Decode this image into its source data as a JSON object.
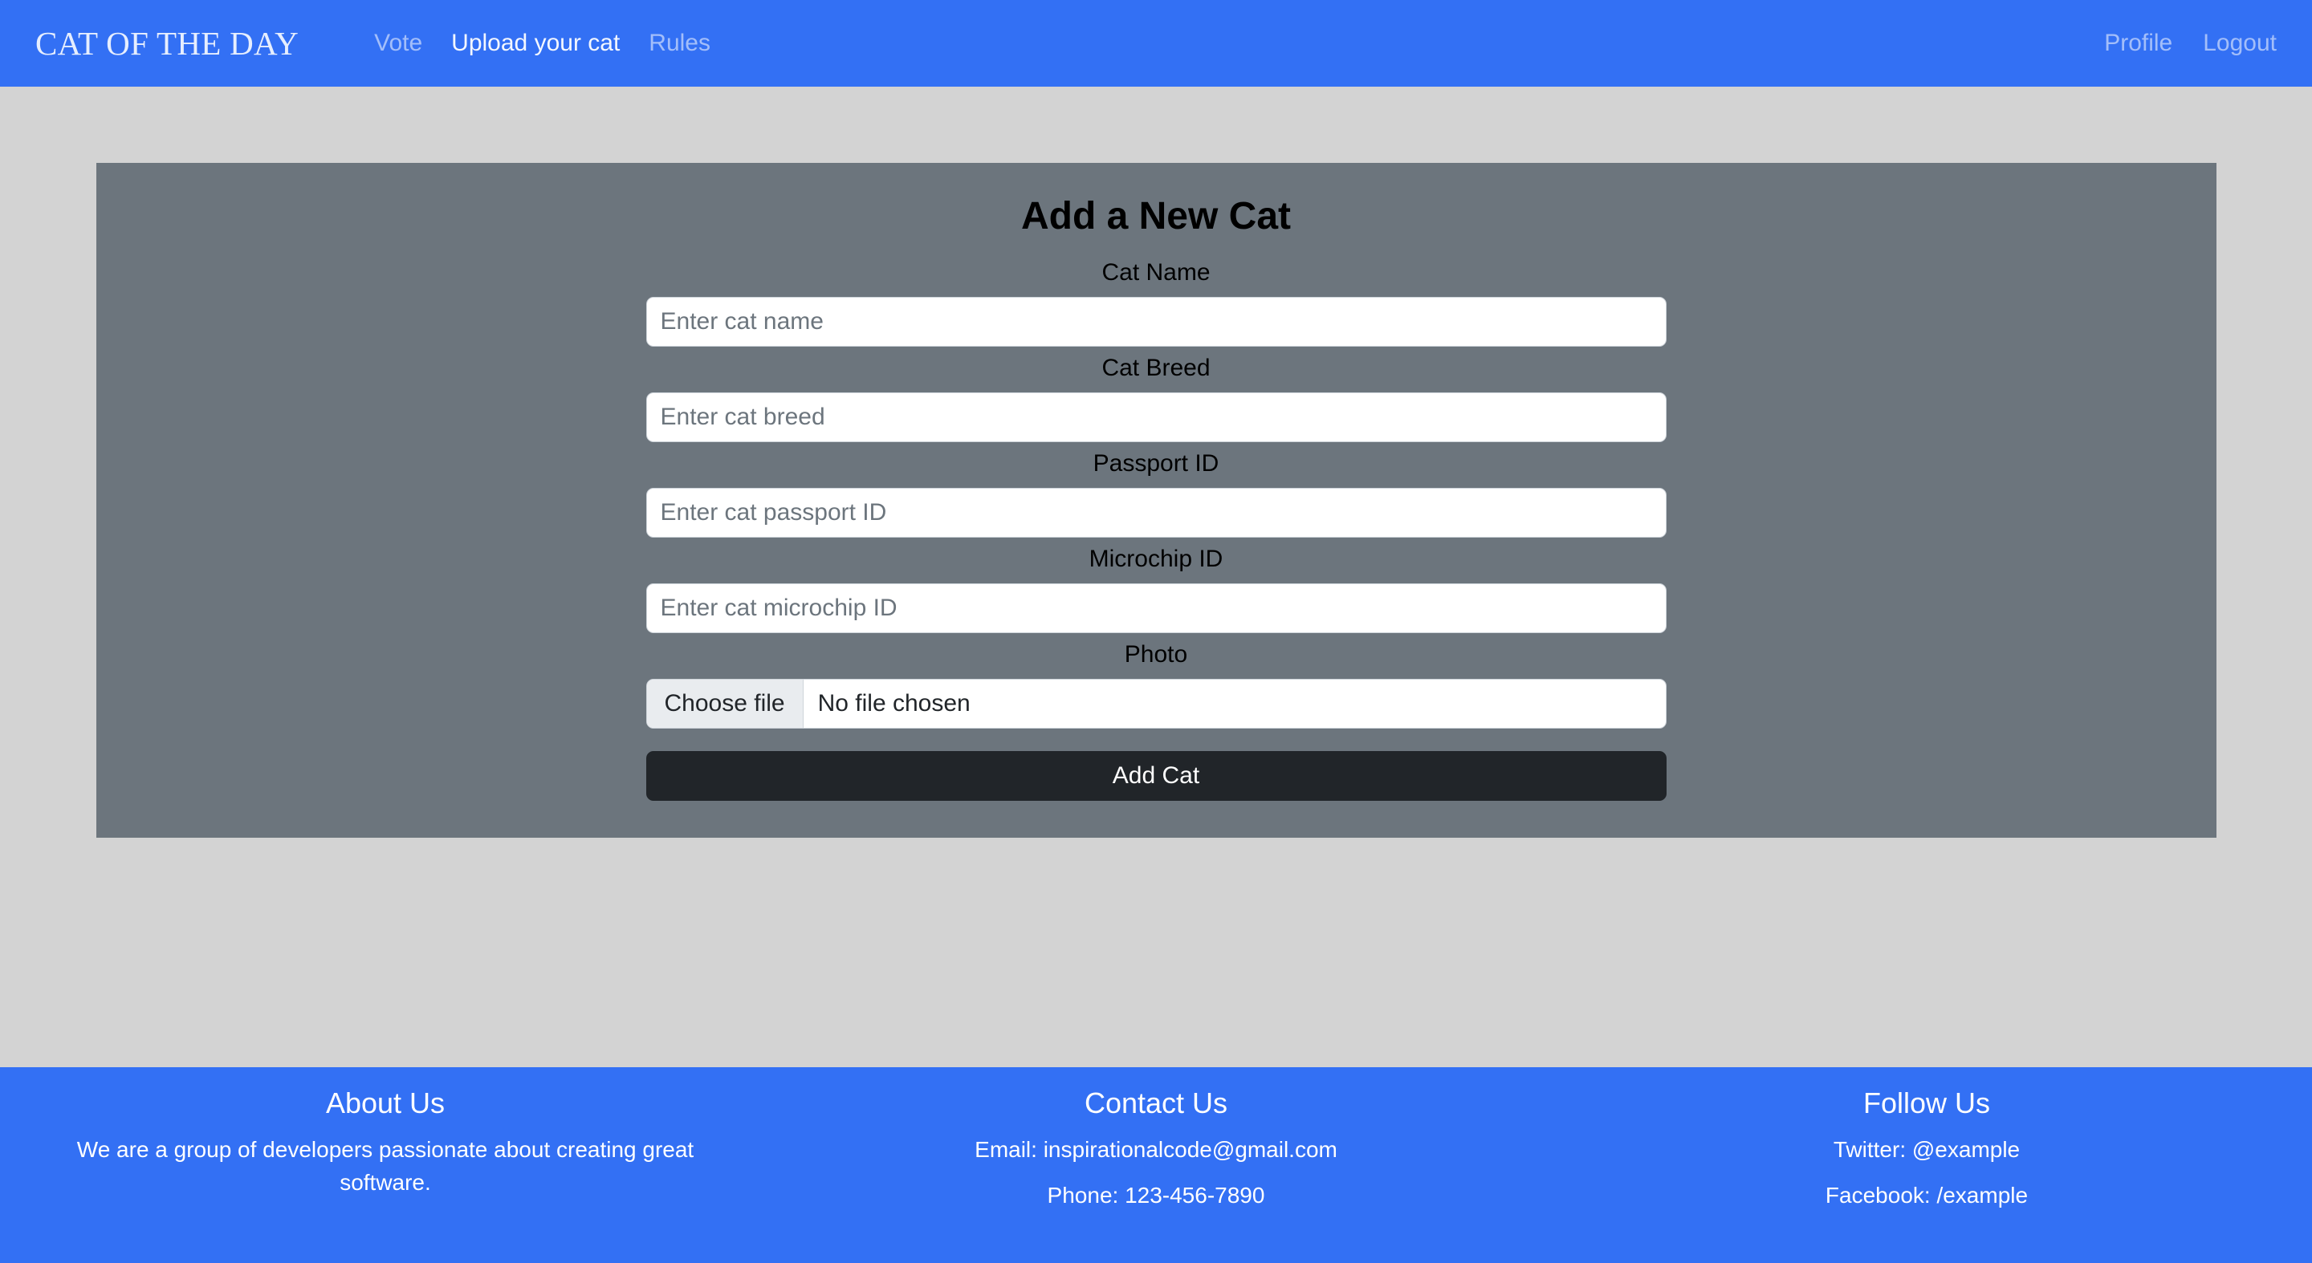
{
  "theme": {
    "brand_blue": "#3370f4",
    "page_background": "#d3d3d3",
    "card_background": "#6c757d",
    "button_dark": "#212529",
    "file_button_background": "#e9ecef"
  },
  "navbar": {
    "brand": "CAT OF THE DAY",
    "links": [
      {
        "label": "Vote",
        "active": false
      },
      {
        "label": "Upload your cat",
        "active": true
      },
      {
        "label": "Rules",
        "active": false
      }
    ],
    "right_links": [
      {
        "label": "Profile"
      },
      {
        "label": "Logout"
      }
    ]
  },
  "main": {
    "card_title": "Add a New Cat",
    "fields": [
      {
        "label": "Cat Name",
        "placeholder": "Enter cat name",
        "value": ""
      },
      {
        "label": "Cat Breed",
        "placeholder": "Enter cat breed",
        "value": ""
      },
      {
        "label": "Passport ID",
        "placeholder": "Enter cat passport ID",
        "value": ""
      },
      {
        "label": "Microchip ID",
        "placeholder": "Enter cat microchip ID",
        "value": ""
      }
    ],
    "photo": {
      "label": "Photo",
      "choose_button": "Choose file",
      "file_status": "No file chosen"
    },
    "submit_label": "Add Cat"
  },
  "footer": {
    "about": {
      "heading": "About Us",
      "text": "We are a group of developers passionate about creating great software."
    },
    "contact": {
      "heading": "Contact Us",
      "email": "Email: inspirationalcode@gmail.com",
      "phone": "Phone: 123-456-7890"
    },
    "follow": {
      "heading": "Follow Us",
      "twitter": "Twitter: @example",
      "facebook": "Facebook: /example"
    }
  }
}
